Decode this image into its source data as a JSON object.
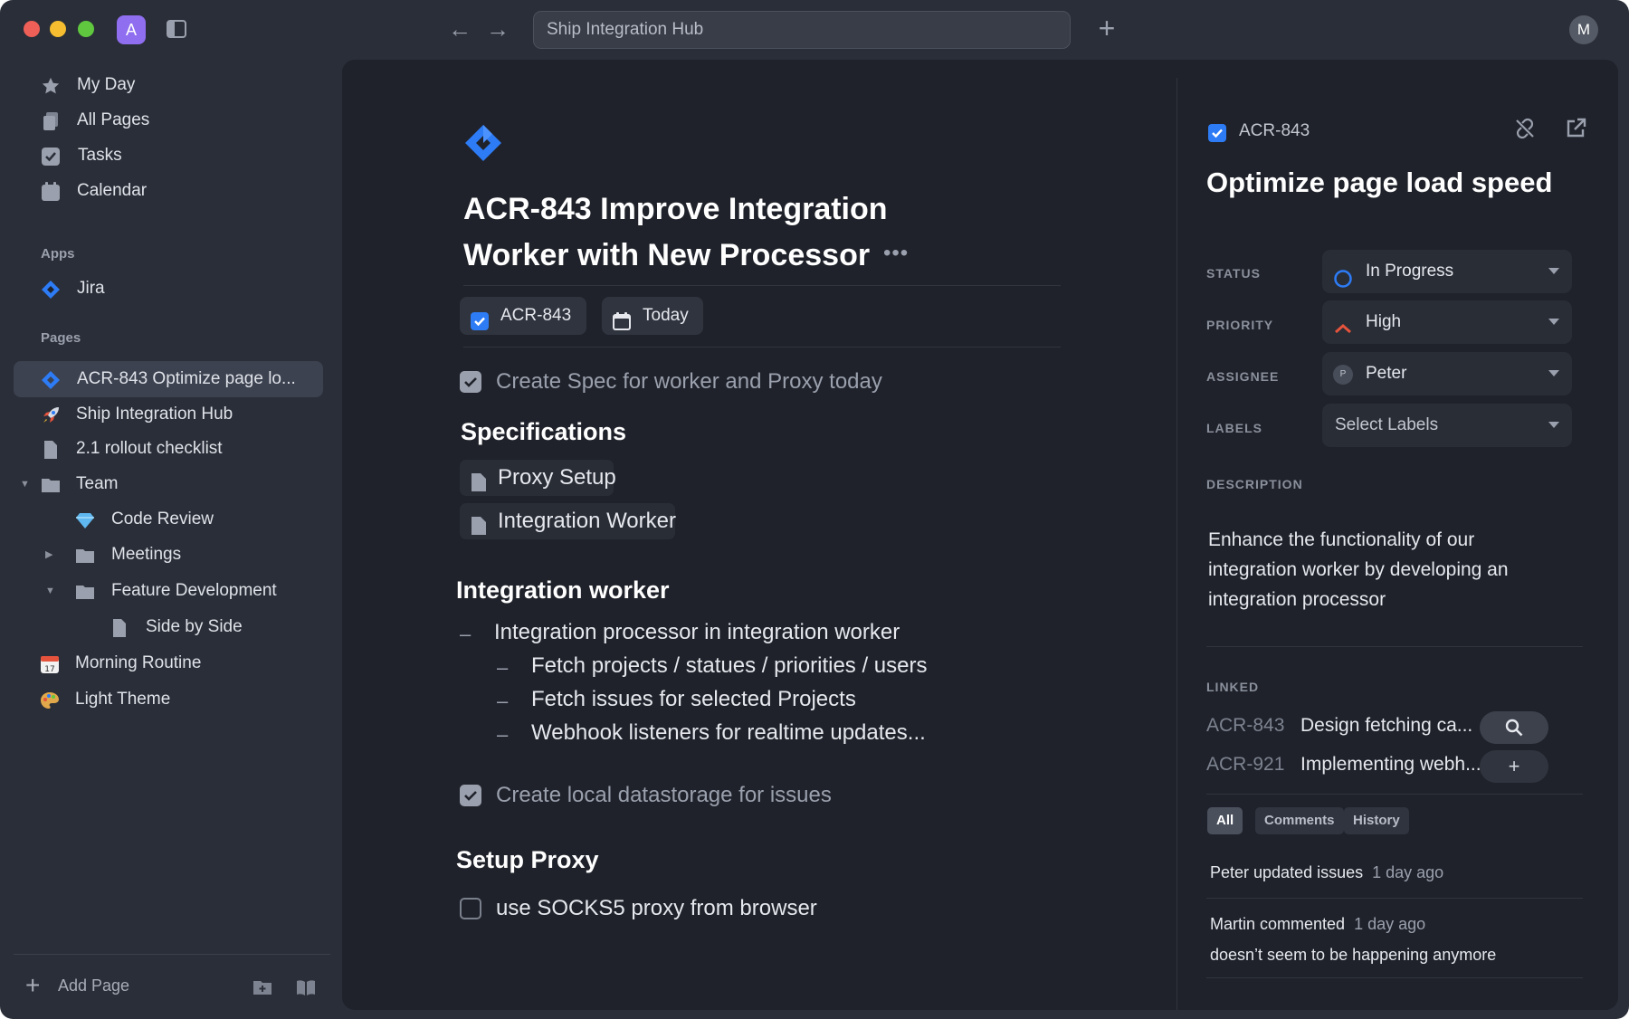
{
  "titlebar": {
    "workspace_initial": "A",
    "address": "Ship Integration Hub",
    "user_initial": "M"
  },
  "sidebar": {
    "top_items": [
      {
        "label": "My Day",
        "icon": "star-icon"
      },
      {
        "label": "All Pages",
        "icon": "pages-icon"
      },
      {
        "label": "Tasks",
        "icon": "checkbox-icon"
      },
      {
        "label": "Calendar",
        "icon": "calendar-icon"
      }
    ],
    "apps_heading": "Apps",
    "apps": [
      {
        "label": "Jira",
        "icon": "jira-icon"
      }
    ],
    "pages_heading": "Pages",
    "pages": [
      {
        "label": "ACR-843 Optimize page lo...",
        "icon": "jira-icon",
        "active": true
      },
      {
        "label": "Ship Integration Hub",
        "icon": "rocket-icon"
      },
      {
        "label": "2.1 rollout checklist",
        "icon": "document-icon"
      },
      {
        "label": "Team",
        "icon": "folder-icon",
        "expanded": true
      },
      {
        "label": "Code Review",
        "icon": "gem-icon"
      },
      {
        "label": "Meetings",
        "icon": "folder-icon",
        "expanded": false
      },
      {
        "label": "Feature Development",
        "icon": "folder-icon",
        "expanded": true
      },
      {
        "label": "Side by Side",
        "icon": "document-icon"
      },
      {
        "label": "Morning Routine",
        "icon": "calendar-emoji-icon"
      },
      {
        "label": "Light Theme",
        "icon": "palette-icon"
      }
    ],
    "add_page": "Add Page"
  },
  "editor": {
    "title": "ACR-843 Improve Integration Worker with New Processor",
    "chips": {
      "issue": "ACR-843",
      "date": "Today"
    },
    "task1": "Create Spec for worker and Proxy today",
    "specs_heading": "Specifications",
    "spec_links": [
      "Proxy Setup",
      "Integration Worker"
    ],
    "worker_heading": "Integration worker",
    "worker_bullet": "Integration processor in integration worker",
    "worker_subbullets": [
      "Fetch projects / statues / priorities / users",
      "Fetch issues for selected Projects",
      "Webhook listeners for realtime updates..."
    ],
    "task2": "Create local datastorage for issues",
    "proxy_heading": "Setup Proxy",
    "task3": "use SOCKS5 proxy from browser"
  },
  "details": {
    "issue_key": "ACR-843",
    "title": "Optimize page load speed",
    "fields": {
      "status_label": "STATUS",
      "status_value": "In Progress",
      "priority_label": "PRIORITY",
      "priority_value": "High",
      "assignee_label": "ASSIGNEE",
      "assignee_value": "Peter",
      "assignee_initial": "P",
      "labels_label": "LABELS",
      "labels_placeholder": "Select Labels"
    },
    "description_label": "DESCRIPTION",
    "description": "Enhance the functionality of our integration worker by developing an integration processor",
    "linked_label": "LINKED",
    "linked": [
      {
        "key": "ACR-843",
        "title": "Design fetching ca..."
      },
      {
        "key": "ACR-921",
        "title": "Implementing webh..."
      }
    ],
    "tabs": [
      "All",
      "Comments",
      "History"
    ],
    "activity": [
      {
        "text": "Peter updated issues",
        "when": "1 day ago"
      },
      {
        "text": "Martin commented",
        "when": "1 day ago",
        "comment": "doesn’t seem to be happening anymore"
      }
    ]
  },
  "colors": {
    "background": "#2a2e38",
    "panel": "#1f222a",
    "accent": "#2d7cf6",
    "priority_high": "#e5533d"
  }
}
